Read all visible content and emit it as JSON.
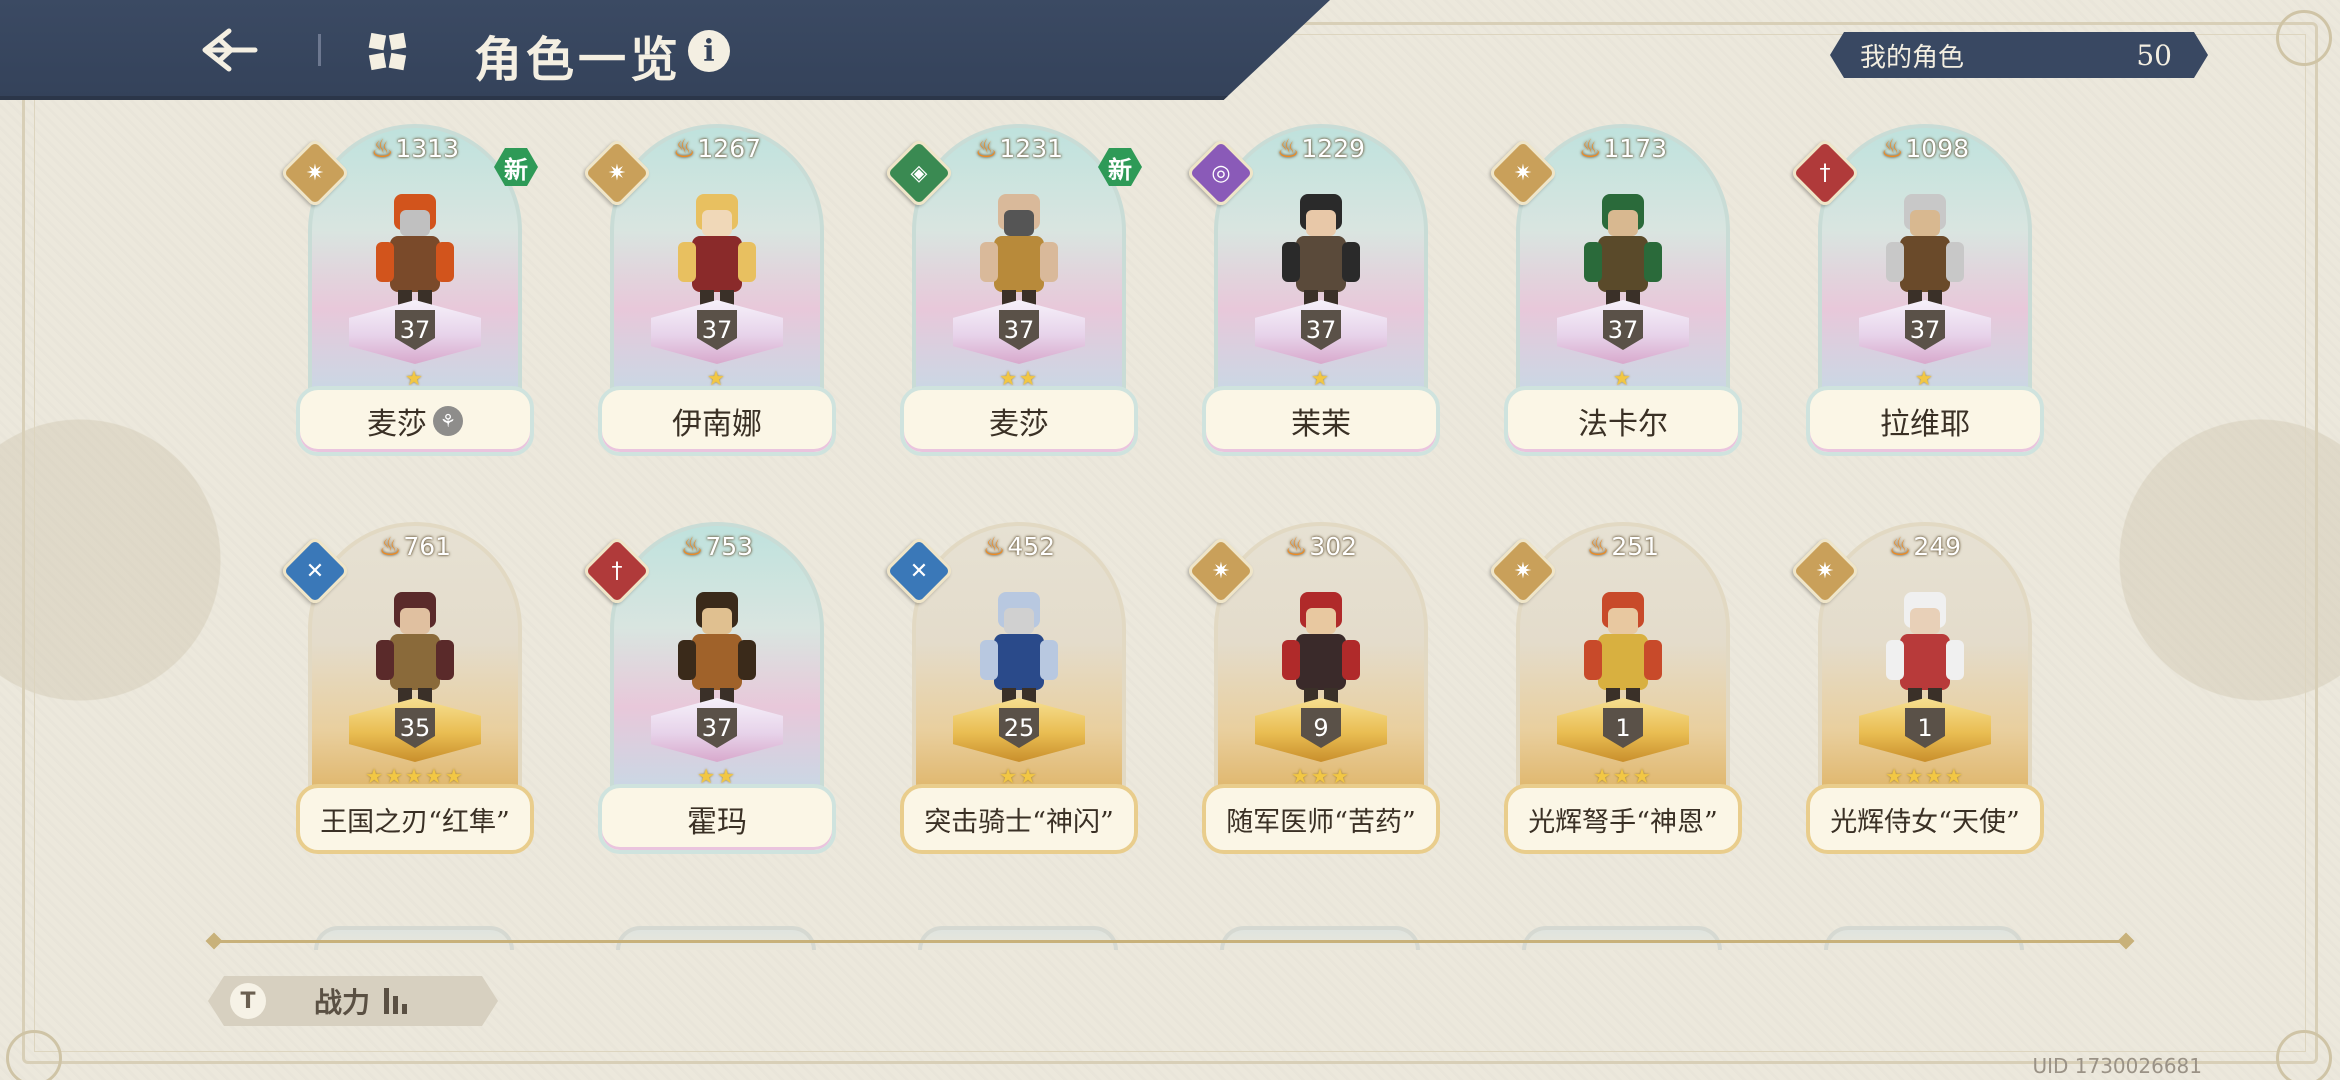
{
  "header": {
    "title": "角色一览",
    "info_icon": "i",
    "back_icon": "back-arrow-icon",
    "menu_icon": "grid-menu-icon"
  },
  "my_characters": {
    "label": "我的角色",
    "value": "50"
  },
  "characters": [
    {
      "name": "麦莎",
      "awakened_icon": "⚘",
      "power": "1313",
      "level": "37",
      "stars": "★",
      "element": "sun",
      "is_new": true,
      "new_label": "新"
    },
    {
      "name": "伊南娜",
      "power": "1267",
      "level": "37",
      "stars": "★",
      "element": "sun",
      "is_new": false
    },
    {
      "name": "麦莎",
      "power": "1231",
      "level": "37",
      "stars": "★★",
      "element": "shield",
      "is_new": true,
      "new_label": "新"
    },
    {
      "name": "茉茉",
      "power": "1229",
      "level": "37",
      "stars": "★",
      "element": "void",
      "is_new": false
    },
    {
      "name": "法卡尔",
      "power": "1173",
      "level": "37",
      "stars": "★",
      "element": "sun",
      "is_new": false
    },
    {
      "name": "拉维耶",
      "power": "1098",
      "level": "37",
      "stars": "★",
      "element": "sword",
      "is_new": false
    },
    {
      "name": "王国之刃“红隼”",
      "power": "761",
      "level": "35",
      "stars": "★★★★★",
      "element": "wind",
      "is_new": false
    },
    {
      "name": "霍玛",
      "power": "753",
      "level": "37",
      "stars": "★★",
      "element": "sword",
      "is_new": false
    },
    {
      "name": "突击骑士“神闪”",
      "power": "452",
      "level": "25",
      "stars": "★★",
      "element": "wind",
      "is_new": false
    },
    {
      "name": "随军医师“苦药”",
      "power": "302",
      "level": "9",
      "stars": "★★★",
      "element": "sun",
      "is_new": false
    },
    {
      "name": "光辉弩手“神恩”",
      "power": "251",
      "level": "1",
      "stars": "★★★",
      "element": "sun",
      "is_new": false
    },
    {
      "name": "光辉侍女“天使”",
      "power": "249",
      "level": "1",
      "stars": "★★★★",
      "element": "sun",
      "is_new": false
    }
  ],
  "element_colors": {
    "sun": "#c9a05a",
    "shield": "#3a8a52",
    "void": "#8a5ab8",
    "sword": "#b03a3a",
    "wind": "#3a78b8"
  },
  "element_glyphs": {
    "sun": "✷",
    "shield": "◈",
    "void": "◎",
    "sword": "†",
    "wind": "✕"
  },
  "sort": {
    "label": "战力",
    "icon": "sort-filter-icon"
  },
  "uid": "UID 1730026681"
}
